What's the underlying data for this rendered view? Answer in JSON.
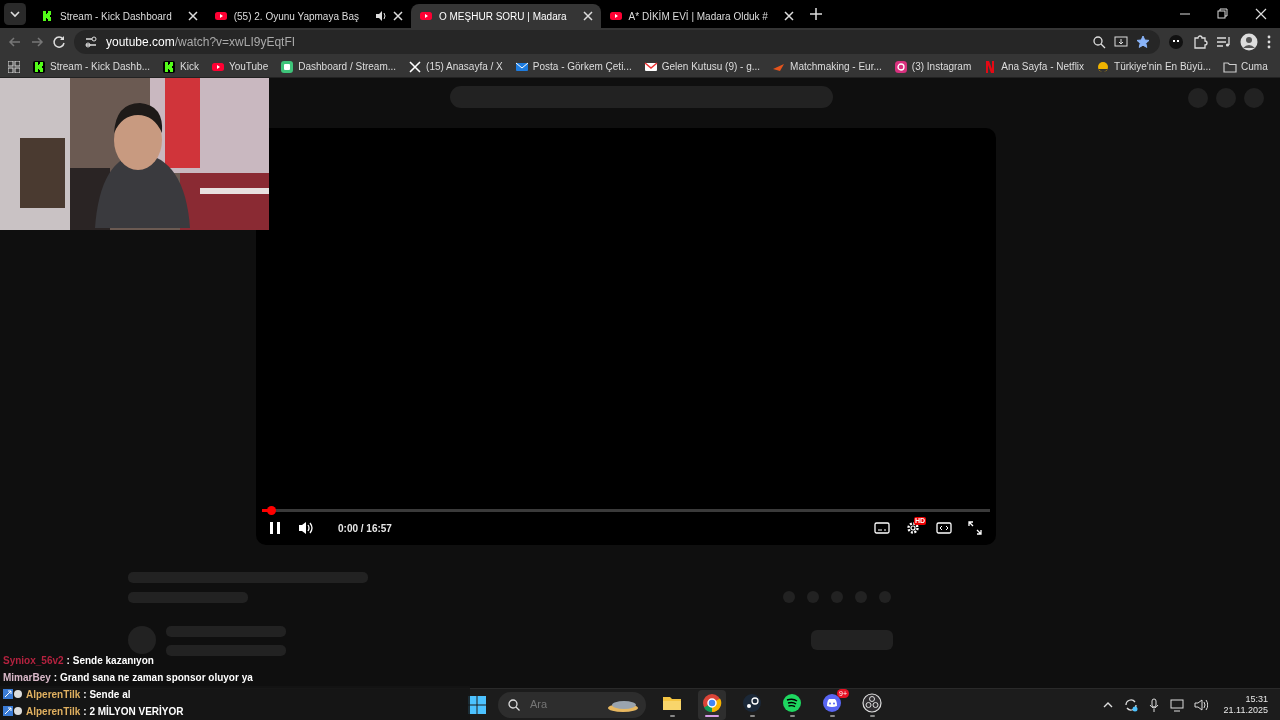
{
  "tabs": [
    {
      "label": "Stream - Kick Dashboard",
      "kind": "kick",
      "selected": false,
      "audio": false
    },
    {
      "label": "(55) 2. Oyunu Yapmaya Baş",
      "kind": "youtube",
      "selected": false,
      "audio": true
    },
    {
      "label": "O MEŞHUR SORU | Madara",
      "kind": "youtube",
      "selected": true,
      "audio": false
    },
    {
      "label": "A* DİKİM EVİ | Madara Olduk #",
      "kind": "youtube",
      "selected": false,
      "audio": false
    }
  ],
  "address": {
    "domain": "youtube.com",
    "path": "/watch?v=xwLI9yEqtFI",
    "bookmarked": true
  },
  "bookmarks": [
    {
      "label": "Stream - Kick Dashb...",
      "kind": "kick"
    },
    {
      "label": "Kick",
      "kind": "kick"
    },
    {
      "label": "YouTube",
      "kind": "youtube"
    },
    {
      "label": "Dashboard / Stream...",
      "kind": "dashboard"
    },
    {
      "label": "(15) Anasayfa / X",
      "kind": "x"
    },
    {
      "label": "Posta - Görkem Çeti...",
      "kind": "mail"
    },
    {
      "label": "Gelen Kutusu (9) - g...",
      "kind": "gmail"
    },
    {
      "label": "Matchmaking - Eur...",
      "kind": "match"
    },
    {
      "label": "(3) Instagram",
      "kind": "instagram"
    },
    {
      "label": "Ana Sayfa - Netflix",
      "kind": "netflix"
    },
    {
      "label": "Türkiye'nin En Büyü...",
      "kind": "site"
    },
    {
      "label": "Cuma",
      "kind": "folder"
    }
  ],
  "player": {
    "time": "0:00 / 16:57",
    "level": 0.012,
    "playing": true,
    "settings_badge": "HD"
  },
  "chat": [
    {
      "user": "Syniox_56v2",
      "color": "#b4223f",
      "text": ": Sende kazanıyon",
      "badges": false
    },
    {
      "user": "MimarBey",
      "color": "#d9b8c8",
      "text": ": Grand sana ne zaman sponsor oluyor ya",
      "badges": false
    },
    {
      "user": "AlperenTilk",
      "color": "#e0b060",
      "text": ": Sende al",
      "badges": true
    },
    {
      "user": "AlperenTilk",
      "color": "#e0b060",
      "text": ": 2 MİLYON VERİYOR",
      "badges": true
    }
  ],
  "taskbar": {
    "search_placeholder": "Ara",
    "apps": [
      {
        "kind": "explorer",
        "selected": false
      },
      {
        "kind": "chrome",
        "selected": true
      },
      {
        "kind": "steam",
        "selected": false
      },
      {
        "kind": "spotify",
        "selected": false
      },
      {
        "kind": "discord",
        "selected": false,
        "badge": "9+"
      },
      {
        "kind": "obs",
        "selected": false
      }
    ],
    "time": "15:31",
    "date": "21.11.2025"
  }
}
